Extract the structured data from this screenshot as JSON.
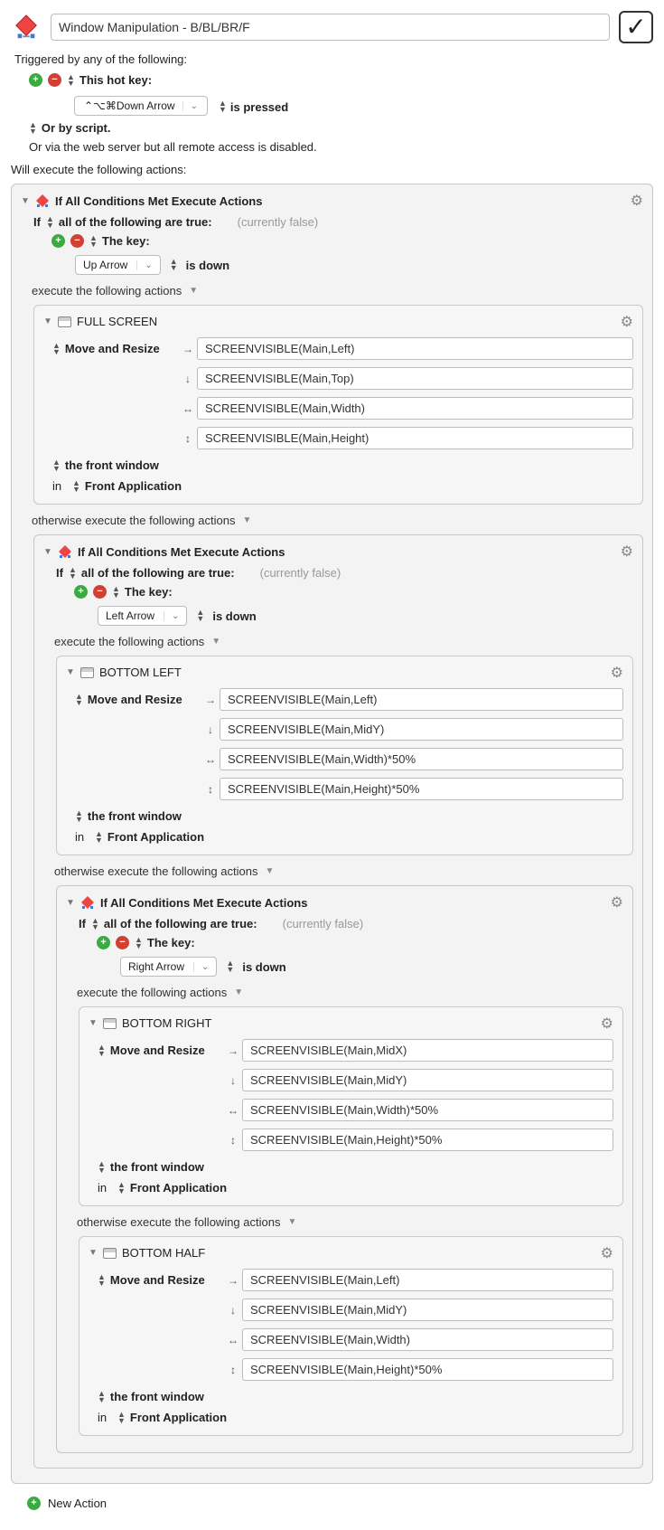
{
  "header": {
    "title": "Window Manipulation - B/BL/BR/F",
    "enabled_check": "✓"
  },
  "labels": {
    "triggered_by": "Triggered by any of the following:",
    "this_hot_key": "This hot key:",
    "or_by_script": "Or by script.",
    "web_server_note": "Or via the web server but all remote access is disabled.",
    "will_execute": "Will execute the following actions:",
    "if_all_conditions": "If All Conditions Met Execute Actions",
    "if": "If",
    "all_true": "all of the following are true:",
    "currently_false": "(currently false)",
    "the_key": "The key:",
    "is_down": "is down",
    "is_pressed": "is pressed",
    "execute_following": "execute the following actions",
    "otherwise_execute": "otherwise execute the following actions",
    "move_and_resize": "Move and Resize",
    "the_front_window": "the front window",
    "in": "in",
    "front_application": "Front Application",
    "new_action": "New Action"
  },
  "hotkey": {
    "combo": "⌃⌥⌘Down Arrow"
  },
  "cond1": {
    "key_select": "Up Arrow",
    "action_title": "FULL SCREEN",
    "params": {
      "left": "SCREENVISIBLE(Main,Left)",
      "top": "SCREENVISIBLE(Main,Top)",
      "width": "SCREENVISIBLE(Main,Width)",
      "height": "SCREENVISIBLE(Main,Height)"
    }
  },
  "cond2": {
    "key_select": "Left Arrow",
    "action_title": "BOTTOM LEFT",
    "params": {
      "left": "SCREENVISIBLE(Main,Left)",
      "top": "SCREENVISIBLE(Main,MidY)",
      "width": "SCREENVISIBLE(Main,Width)*50%",
      "height": "SCREENVISIBLE(Main,Height)*50%"
    }
  },
  "cond3": {
    "key_select": "Right Arrow",
    "action_title": "BOTTOM RIGHT",
    "params": {
      "left": "SCREENVISIBLE(Main,MidX)",
      "top": "SCREENVISIBLE(Main,MidY)",
      "width": "SCREENVISIBLE(Main,Width)*50%",
      "height": "SCREENVISIBLE(Main,Height)*50%"
    }
  },
  "cond4": {
    "action_title": "BOTTOM HALF",
    "params": {
      "left": "SCREENVISIBLE(Main,Left)",
      "top": "SCREENVISIBLE(Main,MidY)",
      "width": "SCREENVISIBLE(Main,Width)",
      "height": "SCREENVISIBLE(Main,Height)*50%"
    }
  }
}
